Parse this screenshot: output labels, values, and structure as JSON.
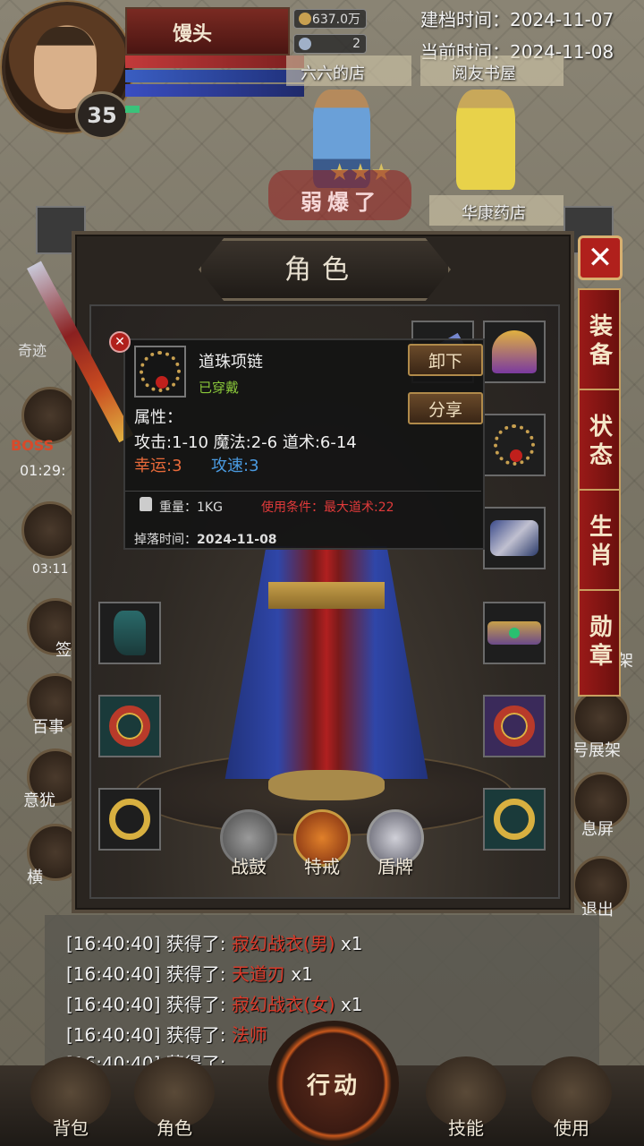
{
  "player": {
    "name": "馒头",
    "level": "35",
    "gold": "637.0万",
    "gems": "2"
  },
  "dates": {
    "created_label": "建档时间：",
    "created_value": "2024-11-07",
    "current_label": "当前时间：",
    "current_value": "2024-11-08"
  },
  "map": {
    "shop1": "六六的店",
    "shop2": "阅友书屋",
    "shop3": "华康药店",
    "banner": "弱爆了",
    "left_label": "奇迹",
    "boss_label": "BOSS",
    "timer1": "01:29:",
    "timer2": "03:11",
    "side_left": [
      "签",
      "百事",
      "意犹",
      "横"
    ],
    "side_right": [
      "架",
      "号展架",
      "息屏",
      "退出"
    ]
  },
  "panel": {
    "title": "角色",
    "close": "✕",
    "tabs": [
      "装备",
      "状态",
      "生肖",
      "勋章"
    ]
  },
  "special_slots": [
    "战鼓",
    "特戒",
    "盾牌"
  ],
  "tooltip": {
    "item_name": "道珠项链",
    "equipped": "已穿戴",
    "unequip_btn": "卸下",
    "share_btn": "分享",
    "attr_header": "属性：",
    "attr_line1": "攻击:1-10  魔法:2-6  道术:6-14",
    "luck": "幸运:3",
    "attack_speed": "攻速:3",
    "weight": "重量：1KG",
    "requirement": "使用条件：最大道术:22",
    "drop_label": "掉落时间：",
    "drop_value": "2024-11-08"
  },
  "log": [
    {
      "time": "[16:40:40]",
      "text": " 获得了: ",
      "item": "寂幻战衣(男)",
      "qty": " x1"
    },
    {
      "time": "[16:40:40]",
      "text": " 获得了: ",
      "item": "天道刃",
      "qty": " x1"
    },
    {
      "time": "[16:40:40]",
      "text": " 获得了: ",
      "item": "寂幻战衣(女)",
      "qty": " x1"
    },
    {
      "time": "[16:40:40]",
      "text": " 获得了: ",
      "item": "法师",
      "qty": ""
    },
    {
      "time": "[16:40:40]",
      "text": " 获得了: ",
      "item": "",
      "qty": ""
    }
  ],
  "bottom_nav": {
    "bag": "背包",
    "role": "角色",
    "action": "行动",
    "skill": "技能",
    "use": "使用"
  },
  "colors": {
    "panel_tab": "#9a1a18",
    "luck": "#e86a3a",
    "attack_speed": "#4a9ae0",
    "requirement": "#e03a3a",
    "equipped": "#8ac83a"
  }
}
